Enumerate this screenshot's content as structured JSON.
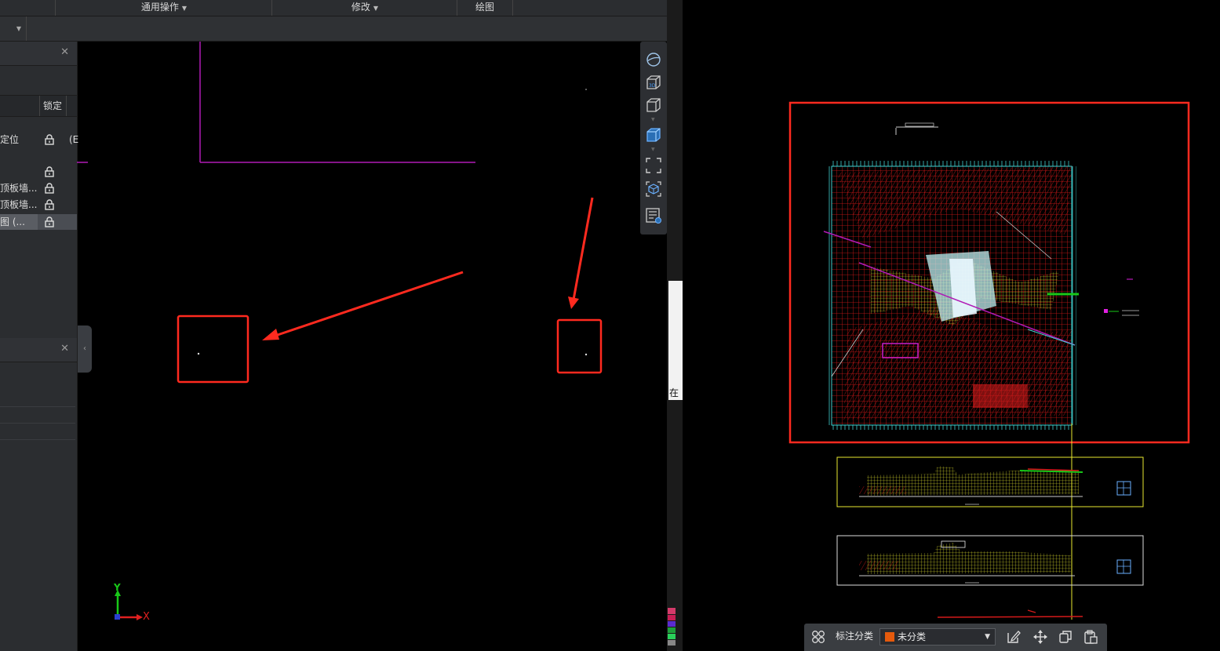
{
  "ribbon": {
    "tabs": [
      {
        "label": "通用操作",
        "has_dropdown": true
      },
      {
        "label": "修改",
        "has_dropdown": true
      },
      {
        "label": "绘图",
        "has_dropdown": false
      }
    ]
  },
  "layer_panel": {
    "column_lock_header": "锁定",
    "rows": [
      {
        "name": "定位",
        "extra": "(E"
      },
      {
        "name": "",
        "extra": ""
      },
      {
        "name": "顶板墙...",
        "extra": ""
      },
      {
        "name": "顶板墙...",
        "extra": ""
      },
      {
        "name": "图 (...",
        "extra": "",
        "selected": true
      }
    ]
  },
  "axis_labels": {
    "y": "Y",
    "x": "X"
  },
  "middle_strip": {
    "text": "在"
  },
  "annotation_bar": {
    "label": "标注分类",
    "select_value": "未分类",
    "swatch_color": "#e55a0c"
  },
  "colors": {
    "highlight_red": "#ff2a1f",
    "magenta_line": "#b01ab5",
    "viewport_yellow": "#e8e830"
  }
}
